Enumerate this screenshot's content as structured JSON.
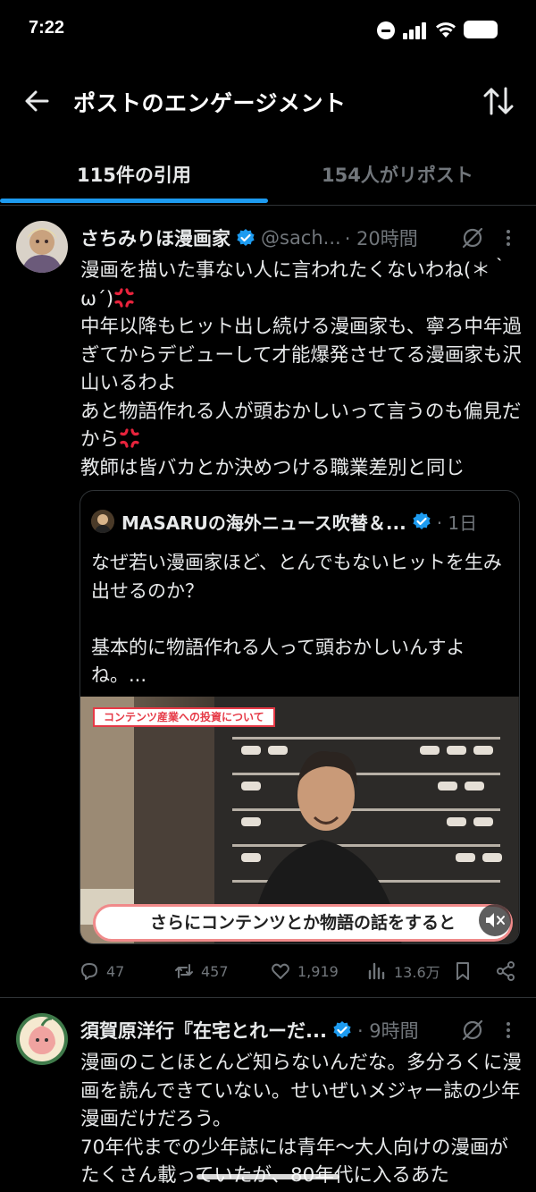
{
  "status_bar": {
    "time": "7:22"
  },
  "header": {
    "title": "ポストのエンゲージメント"
  },
  "tabs": [
    {
      "label": "115件の引用",
      "active": true
    },
    {
      "label": "154人がリポスト",
      "active": false
    }
  ],
  "tweets": [
    {
      "name": "さちみりほ漫画家",
      "handle": "@sach...",
      "time": "· 20時間",
      "text": [
        "漫画を描いた事ない人に言われたくないわね(＊｀ω´)",
        "中年以降もヒット出し続ける漫画家も、寧ろ中年過ぎてからデビューして才能爆発させてる漫画家も沢山いるわよ",
        "あと物語作れる人が頭おかしいって言うのも偏見だから",
        "教師は皆バカとか決めつける職業差別と同じ"
      ],
      "quote": {
        "name": "MASARUの海外ニュース吹替＆...",
        "time": "· 1日",
        "text": [
          "なぜ若い漫画家ほど、とんでもないヒットを生み出せるのか？",
          "",
          "基本的に物語作れる人って頭おかしいんすよね。..."
        ],
        "media_tag": "コンテンツ産業への投資について",
        "media_caption": "さらにコンテンツとか物語の話をすると"
      },
      "stats": {
        "replies": "47",
        "reposts": "457",
        "likes": "1,919",
        "views": "13.6万"
      }
    },
    {
      "name": "須賀原洋行『在宅とれーだ...",
      "time": "· 9時間",
      "text": [
        "漫画のことほとんど知らないんだな。多分ろくに漫画を読んできていない。せいぜいメジャー誌の少年漫画だけだろう。",
        "70年代までの少年誌には青年〜大人向けの漫画がたくさん載っていたが、80年代に入るあた"
      ]
    }
  ],
  "colors": {
    "background": "#000000",
    "text": "#e7e9ea",
    "secondary": "#71767b",
    "accent": "#1d9bf0",
    "divider": "#2f3336"
  },
  "icons": [
    "back-arrow-icon",
    "sort-icon",
    "verified-icon",
    "grok-icon",
    "more-icon",
    "reply-icon",
    "repost-icon",
    "like-icon",
    "views-icon",
    "bookmark-icon",
    "share-icon",
    "mute-icon",
    "anger-emoji-icon"
  ]
}
